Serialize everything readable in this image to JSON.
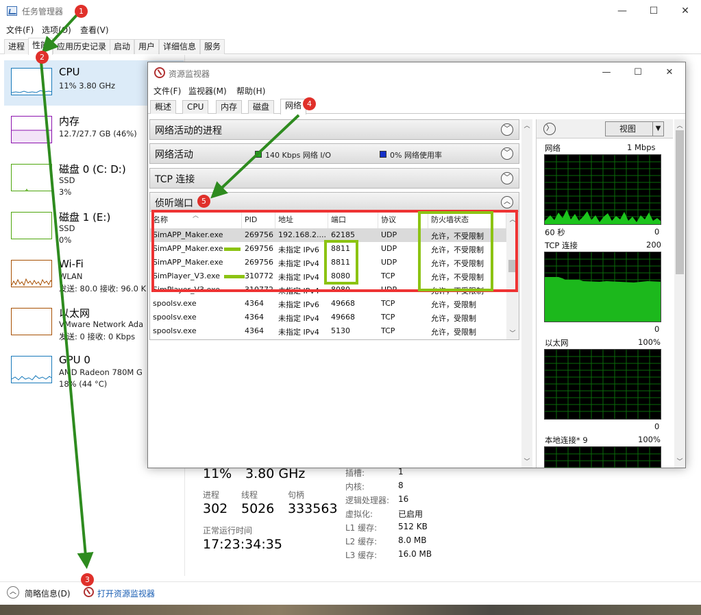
{
  "task_manager": {
    "title": "任务管理器",
    "window_controls": {
      "minimize": "—",
      "maximize": "☐",
      "close": "✕"
    },
    "menu": [
      "文件(F)",
      "选项(O)",
      "查看(V)"
    ],
    "tabs": [
      "进程",
      "性能",
      "应用历史记录",
      "启动",
      "用户",
      "详细信息",
      "服务"
    ],
    "active_tab": "性能",
    "perf_items": [
      {
        "name": "CPU",
        "line1": "11% 3.80 GHz",
        "line2": "",
        "color": "#1779ba"
      },
      {
        "name": "内存",
        "line1": "12.7/27.7 GB (46%)",
        "line2": "",
        "color": "#8b12ae"
      },
      {
        "name": "磁盘 0 (C: D:)",
        "line1": "SSD",
        "line2": "3%",
        "color": "#4da60c"
      },
      {
        "name": "磁盘 1 (E:)",
        "line1": "SSD",
        "line2": "0%",
        "color": "#4da60c"
      },
      {
        "name": "Wi-Fi",
        "line1": "WLAN",
        "line2": "发送: 80.0  接收: 96.0 K",
        "color": "#a74f01"
      },
      {
        "name": "以太网",
        "line1": "VMware Network Ada",
        "line2": "发送: 0 接收: 0 Kbps",
        "color": "#a74f01"
      },
      {
        "name": "GPU 0",
        "line1": "AMD Radeon 780M G",
        "line2": "18% (44 °C)",
        "color": "#1779ba"
      }
    ],
    "cpu_detail": {
      "utilization": "11%",
      "speed": "3.80 GHz",
      "processes_label": "进程",
      "processes": "302",
      "threads_label": "线程",
      "threads": "5026",
      "handles_label": "句柄",
      "handles": "333563",
      "uptime_label": "正常运行时间",
      "uptime": "17:23:34:35",
      "specs": [
        {
          "k": "插槽:",
          "v": "1"
        },
        {
          "k": "内核:",
          "v": "8"
        },
        {
          "k": "逻辑处理器:",
          "v": "16"
        },
        {
          "k": "虚拟化:",
          "v": "已启用"
        },
        {
          "k": "L1 缓存:",
          "v": "512 KB"
        },
        {
          "k": "L2 缓存:",
          "v": "8.0 MB"
        },
        {
          "k": "L3 缓存:",
          "v": "16.0 MB"
        }
      ]
    },
    "footer": {
      "summary": "简略信息(D)",
      "open_rm": "打开资源监视器"
    }
  },
  "resource_monitor": {
    "title": "资源监视器",
    "window_controls": {
      "minimize": "—",
      "maximize": "☐",
      "close": "✕"
    },
    "menu": [
      "文件(F)",
      "监视器(M)",
      "帮助(H)"
    ],
    "tabs": [
      "概述",
      "CPU",
      "内存",
      "磁盘",
      "网络"
    ],
    "active_tab": "网络",
    "sections": {
      "processes": "网络活动的进程",
      "activity": "网络活动",
      "activity_io": "140 Kbps 网络 I/O",
      "activity_util": "0% 网络使用率",
      "tcp": "TCP 连接",
      "listening": "侦听端口"
    },
    "colors": {
      "io": "#1fa51f",
      "util": "#1530c8"
    },
    "listen_columns": [
      "名称",
      "PID",
      "地址",
      "端口",
      "协议",
      "防火墙状态"
    ],
    "listen_rows": [
      {
        "name": "SimAPP_Maker.exe",
        "pid": "269756",
        "addr": "192.168.2....",
        "port": "62185",
        "proto": "UDP",
        "fw": "允许，不受限制",
        "bar": false,
        "sel": true
      },
      {
        "name": "SimAPP_Maker.exe",
        "pid": "269756",
        "addr": "未指定 IPv6",
        "port": "8811",
        "proto": "UDP",
        "fw": "允许，不受限制",
        "bar": true,
        "sel": false
      },
      {
        "name": "SimAPP_Maker.exe",
        "pid": "269756",
        "addr": "未指定 IPv4",
        "port": "8811",
        "proto": "UDP",
        "fw": "允许，不受限制",
        "bar": false,
        "sel": false
      },
      {
        "name": "SimPlayer_V3.exe",
        "pid": "310772",
        "addr": "未指定 IPv4",
        "port": "8080",
        "proto": "TCP",
        "fw": "允许，不受限制",
        "bar": true,
        "sel": false
      },
      {
        "name": "SimPlayer_V3.exe",
        "pid": "310772",
        "addr": "未指定 IPv4",
        "port": "8080",
        "proto": "UDP",
        "fw": "允许，不受限制",
        "bar": false,
        "sel": false
      },
      {
        "name": "spoolsv.exe",
        "pid": "4364",
        "addr": "未指定 IPv6",
        "port": "49668",
        "proto": "TCP",
        "fw": "允许，受限制",
        "bar": false,
        "sel": false
      },
      {
        "name": "spoolsv.exe",
        "pid": "4364",
        "addr": "未指定 IPv4",
        "port": "49668",
        "proto": "TCP",
        "fw": "允许，受限制",
        "bar": false,
        "sel": false
      },
      {
        "name": "spoolsv.exe",
        "pid": "4364",
        "addr": "未指定 IPv4",
        "port": "5130",
        "proto": "TCP",
        "fw": "允许，受限制",
        "bar": false,
        "sel": false
      }
    ],
    "right_panel": {
      "view_button": "视图",
      "graphs": [
        {
          "label": "网络",
          "max": "1 Mbps",
          "foot_left": "60 秒",
          "foot_right": "0"
        },
        {
          "label": "TCP 连接",
          "max": "200",
          "foot_left": "",
          "foot_right": "0"
        },
        {
          "label": "以太网",
          "max": "100%",
          "foot_left": "",
          "foot_right": "0"
        },
        {
          "label": "本地连接* 9",
          "max": "100%",
          "foot_left": "",
          "foot_right": ""
        }
      ]
    }
  },
  "annotations": [
    "1",
    "2",
    "3",
    "4",
    "5"
  ],
  "annotation_colors": {
    "badge": "#e0302a",
    "arrow": "#2e8b1f",
    "red_box": "#ee3333",
    "green_box": "#8cc313"
  }
}
